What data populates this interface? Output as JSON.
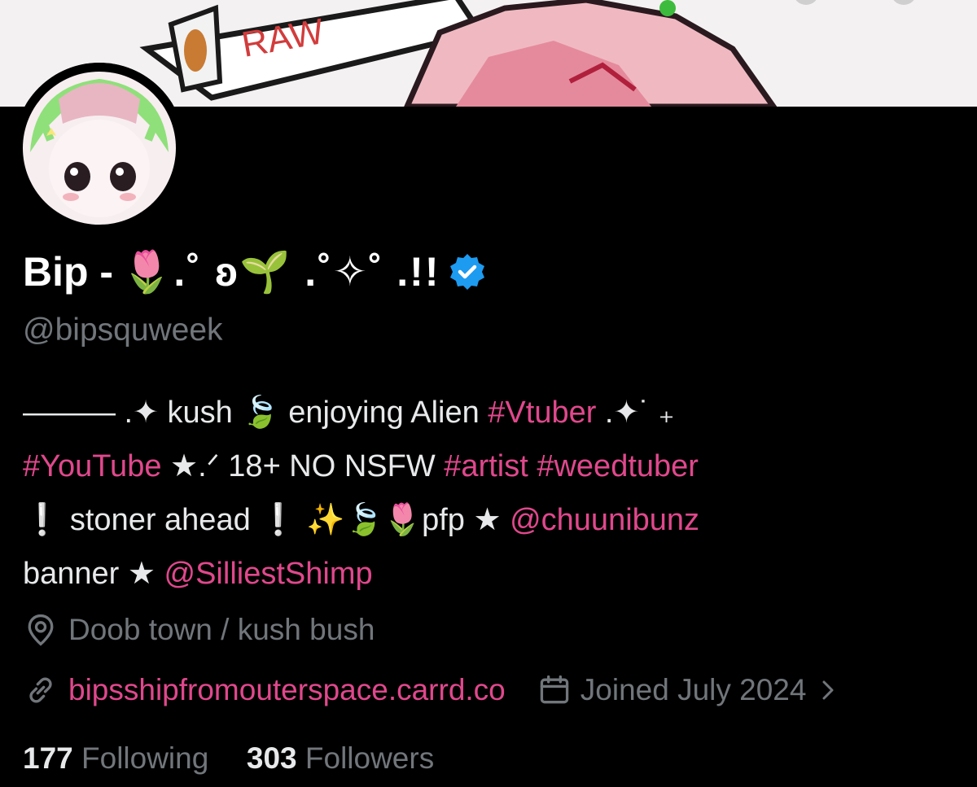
{
  "banner": {
    "text": "RAW"
  },
  "profile": {
    "display_name": "Bip -",
    "display_name_decoration": "🌷.˚ ʚ🌱 .˚✧˚ .!!",
    "handle": "@bipsquweek",
    "verified": true
  },
  "bio": {
    "line1": {
      "a": "——— .✦ kush 🍃 enjoying Alien ",
      "tag": "#Vtuber",
      "b": " .✦˙ ₊"
    },
    "line2": {
      "tag1": "#YouTube",
      "a": " ★.ᐟ 18+ NO NSFW ",
      "tag2": "#artist",
      "tag3": "#weedtuber"
    },
    "line3": {
      "a": " ❕ stoner ahead ❕ ✨🍃🌷pfp ★ ",
      "mention": "@chuunibunz"
    },
    "line4": {
      "a": "banner ★ ",
      "mention": "@SilliestShimp"
    }
  },
  "location": "Doob town / kush bush",
  "website": "bipsshipfromouterspace.carrd.co",
  "joined": "Joined July 2024",
  "stats": {
    "following_count": "177",
    "following_label": "Following",
    "followers_count": "303",
    "followers_label": "Followers"
  },
  "colors": {
    "accent_pink": "#e0488c",
    "verified_blue": "#1d9bf0",
    "muted": "#71767b"
  },
  "icons": {
    "location": "map-pin-icon",
    "link": "link-icon",
    "calendar": "calendar-icon",
    "verified": "verified-badge-icon"
  }
}
